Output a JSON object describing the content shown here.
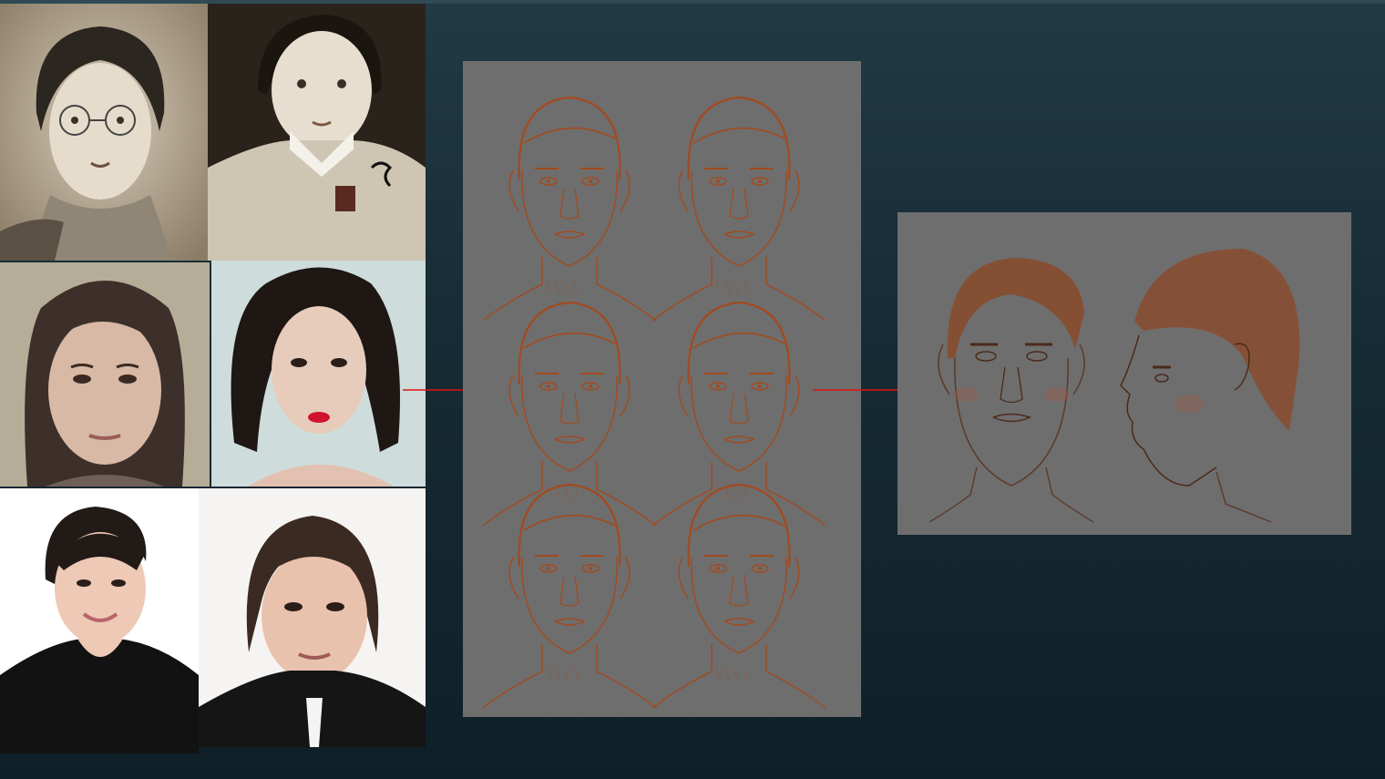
{
  "slide": {
    "background": "#172c36",
    "accent_arrow_color": "#e01010",
    "sketch_stroke_color": "#a34a1d",
    "panel_color": "#6e6e6e"
  },
  "references": [
    {
      "id": "ref-1",
      "icon": "portrait-photo",
      "tone": "sepia"
    },
    {
      "id": "ref-2",
      "icon": "portrait-photo",
      "tone": "sepia"
    },
    {
      "id": "ref-3",
      "icon": "portrait-photo",
      "tone": "color"
    },
    {
      "id": "ref-4",
      "icon": "portrait-photo",
      "tone": "color"
    },
    {
      "id": "ref-5",
      "icon": "portrait-photo",
      "tone": "color"
    },
    {
      "id": "ref-6",
      "icon": "portrait-photo",
      "tone": "color"
    }
  ],
  "sketch_sheet": {
    "face_count": 6
  },
  "final_sheet": {
    "views": [
      "front",
      "profile"
    ]
  }
}
